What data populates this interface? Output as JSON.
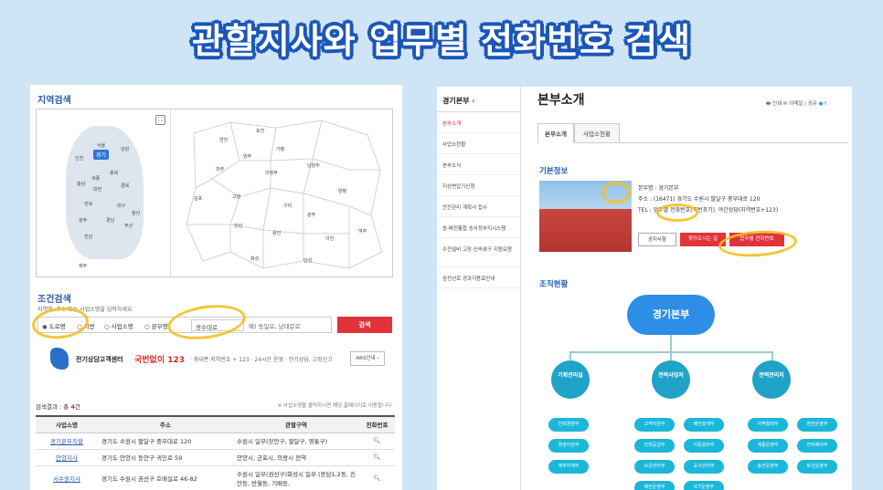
{
  "banner": {
    "title": "관할지사와 업무별 전화번호 검색"
  },
  "left": {
    "region_search_title": "지역검색",
    "map": {
      "highlighted_region": "경기",
      "korea_labels": [
        "서울",
        "경기",
        "강원",
        "인천",
        "충북",
        "세종",
        "대전",
        "충남",
        "경북",
        "전북",
        "대구",
        "울산",
        "광주",
        "부산",
        "경남",
        "전남",
        "제주"
      ],
      "right_map_labels": [
        "포천",
        "양주",
        "의정부",
        "남양주",
        "가평",
        "구리",
        "하남",
        "광주",
        "양평",
        "성남",
        "용인",
        "이천",
        "여주",
        "안성",
        "평택",
        "화성",
        "수원",
        "안산",
        "시흥",
        "광명",
        "부천",
        "김포",
        "고양",
        "파주",
        "연천",
        "동두천",
        "오산",
        "의왕",
        "군포",
        "과천"
      ]
    },
    "condition_title": "조건검색",
    "condition_note": "지역명, 주소 또는 사업소명을 입력하세요.",
    "radios": [
      "도로명",
      "지번",
      "사업소명",
      "본부명"
    ],
    "selected_radio": "도로명",
    "input_value": "경수대로",
    "input_hint": "예) 동일로, 남대문로",
    "search_button": "검색",
    "call_center": {
      "title": "전기상담고객센터",
      "number": "국번없이 123",
      "info": "· 휴대폰 지역번호 + 123 · 24시간 운영 · 전기상담, 고장신고",
      "ars_button": "ARS안내 ›"
    },
    "result": {
      "label": "검색결과 : 총",
      "count": "4",
      "unit": "건"
    },
    "result_note": "※ 사업소명을 클릭하시면 해당 홈페이지로 이동합니다.",
    "table": {
      "headers": [
        "사업소명",
        "주소",
        "관할구역",
        "전화번호"
      ],
      "rows": [
        {
          "name": "경기본부직할",
          "addr": "경기도 수원시 팔달구 중부대로 120",
          "area": "수원시 일부(장안구, 팔달구, 영통구)"
        },
        {
          "name": "안양지사",
          "addr": "경기도 안양시 동안구 귀인로 59",
          "area": "안양시, 군포시, 의왕시 전역"
        },
        {
          "name": "서수원지사",
          "addr": "경기도 수원시 권선구 호매실로 46-82",
          "area": "수원시 일부(권선구)화성시 일부 (봉담1,2동, 진안동, 반월동, 기배동,"
        }
      ]
    }
  },
  "right": {
    "side_title": "경기본부",
    "side_items": [
      "본부소개",
      "사업소현황",
      "본부소식",
      "지상변압기신청",
      "안전관리 계획서 접수",
      "송·배전통합 송사정부지시스템",
      "수전설비 고장·신속복구 지원요청",
      "송전선로 경과지용료안내"
    ],
    "page_title": "본부소개",
    "tools": [
      "인쇄",
      "이메일",
      "공유"
    ],
    "tabs": [
      "본부소개",
      "사업소현황"
    ],
    "basic_info_title": "기본정보",
    "info_lines": [
      "본부명 : 경기본부",
      "주소 : (16471) 경기도 수원시 팔달구 중부대로 120",
      "TEL : 업무별 전화번호(국번포기), 야간상담(지역번호+123)"
    ],
    "buttons": [
      "공지사항",
      "찾아오시는 길",
      "업무별 전화번호"
    ],
    "org_title": "조직현황",
    "org_root": "경기본부",
    "org_children": [
      "기획관리실",
      "전력사업처",
      "전력관리처"
    ],
    "org_leaves": [
      [
        "전략경영부",
        "경영지원부",
        "재무자재부"
      ],
      [
        "고객지원부",
        "전력공급부",
        "요금관리부",
        "배전운영부"
      ],
      [
        "배전설계부",
        "지중설비부",
        "공사관리부",
        "ICT운영부"
      ],
      [
        "지역협력부",
        "계통운영부",
        "송전운영부"
      ],
      [
        "변전운영부",
        "전자제어부",
        "토건운영부"
      ]
    ]
  }
}
